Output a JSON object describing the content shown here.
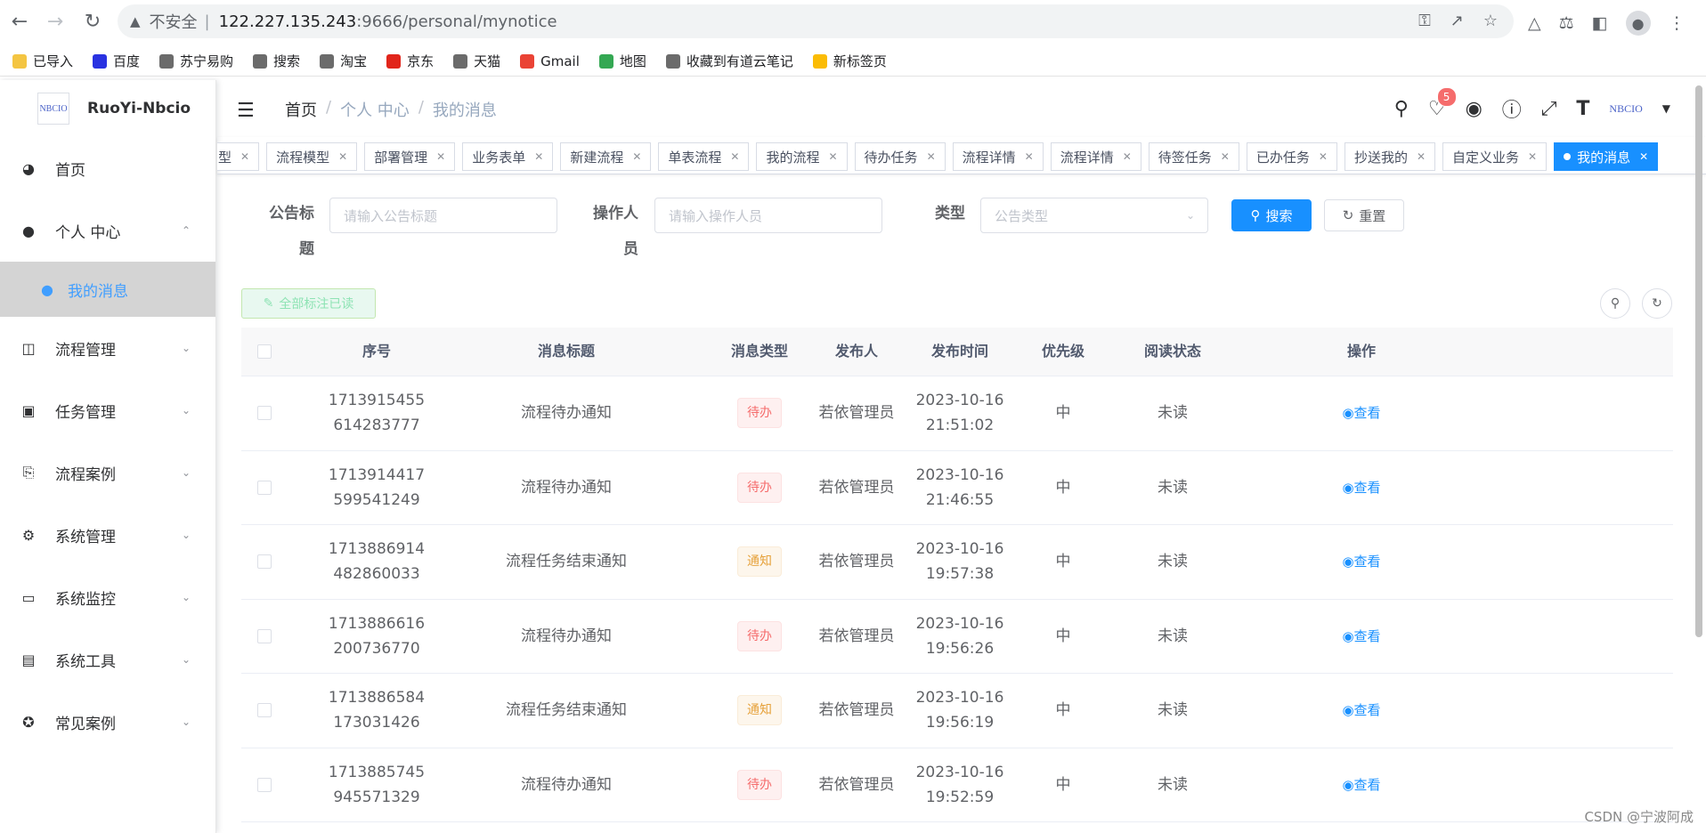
{
  "browser": {
    "security_label": "不安全",
    "url_host": "122.227.135.243",
    "url_path": ":9666/personal/mynotice",
    "bookmarks": [
      {
        "label": "已导入",
        "color": "#f4c542"
      },
      {
        "label": "百度",
        "color": "#2932e1"
      },
      {
        "label": "苏宁易购",
        "color": "#6b6b6b"
      },
      {
        "label": "搜索",
        "color": "#6b6b6b"
      },
      {
        "label": "淘宝",
        "color": "#6b6b6b"
      },
      {
        "label": "京东",
        "color": "#e1251b"
      },
      {
        "label": "天猫",
        "color": "#6b6b6b"
      },
      {
        "label": "Gmail",
        "color": "#ea4335"
      },
      {
        "label": "地图",
        "color": "#34a853"
      },
      {
        "label": "收藏到有道云笔记",
        "color": "#6b6b6b"
      },
      {
        "label": "新标签页",
        "color": "#fbbc05"
      }
    ]
  },
  "sidebar": {
    "logo_text": "NBCIO",
    "title": "RuoYi-Nbcio",
    "items": [
      {
        "label": "首页",
        "icon": "dashboard-icon"
      },
      {
        "label": "个人 中心",
        "icon": "user-icon",
        "expanded": true
      },
      {
        "label": "流程管理",
        "icon": "flow-icon"
      },
      {
        "label": "任务管理",
        "icon": "task-icon"
      },
      {
        "label": "流程案例",
        "icon": "case-icon"
      },
      {
        "label": "系统管理",
        "icon": "gear-icon"
      },
      {
        "label": "系统监控",
        "icon": "monitor-icon"
      },
      {
        "label": "系统工具",
        "icon": "toolbox-icon"
      },
      {
        "label": "常见案例",
        "icon": "example-icon"
      }
    ],
    "submenu_active": "我的消息"
  },
  "header": {
    "breadcrumb": [
      "首页",
      "个人 中心",
      "我的消息"
    ],
    "notification_count": "5",
    "avatar_text": "NBCIO"
  },
  "tags": [
    {
      "label": "型"
    },
    {
      "label": "流程模型"
    },
    {
      "label": "部署管理"
    },
    {
      "label": "业务表单"
    },
    {
      "label": "新建流程"
    },
    {
      "label": "单表流程"
    },
    {
      "label": "我的流程"
    },
    {
      "label": "待办任务"
    },
    {
      "label": "流程详情"
    },
    {
      "label": "流程详情"
    },
    {
      "label": "待签任务"
    },
    {
      "label": "已办任务"
    },
    {
      "label": "抄送我的"
    },
    {
      "label": "自定义业务"
    },
    {
      "label": "我的消息",
      "active": true
    }
  ],
  "form": {
    "title_label_1": "公告标",
    "title_label_2": "题",
    "title_placeholder": "请输入公告标题",
    "operator_label_1": "操作人",
    "operator_label_2": "员",
    "operator_placeholder": "请输入操作人员",
    "type_label": "类型",
    "type_placeholder": "公告类型",
    "search_btn": "搜索",
    "reset_btn": "重置",
    "mark_all_read": "全部标注已读"
  },
  "table": {
    "headers": [
      "序号",
      "消息标题",
      "消息类型",
      "发布人",
      "发布时间",
      "优先级",
      "阅读状态",
      "操作"
    ],
    "view_label": "查看",
    "rows": [
      {
        "no1": "1713915455",
        "no2": "614283777",
        "title": "流程待办通知",
        "type": "待办",
        "type_style": "danger",
        "publisher": "若依管理员",
        "date": "2023-10-16",
        "time": "21:51:02",
        "priority": "中",
        "status": "未读"
      },
      {
        "no1": "1713914417",
        "no2": "599541249",
        "title": "流程待办通知",
        "type": "待办",
        "type_style": "danger",
        "publisher": "若依管理员",
        "date": "2023-10-16",
        "time": "21:46:55",
        "priority": "中",
        "status": "未读"
      },
      {
        "no1": "1713886914",
        "no2": "482860033",
        "title": "流程任务结束通知",
        "type": "通知",
        "type_style": "warning",
        "publisher": "若依管理员",
        "date": "2023-10-16",
        "time": "19:57:38",
        "priority": "中",
        "status": "未读"
      },
      {
        "no1": "1713886616",
        "no2": "200736770",
        "title": "流程待办通知",
        "type": "待办",
        "type_style": "danger",
        "publisher": "若依管理员",
        "date": "2023-10-16",
        "time": "19:56:26",
        "priority": "中",
        "status": "未读"
      },
      {
        "no1": "1713886584",
        "no2": "173031426",
        "title": "流程任务结束通知",
        "type": "通知",
        "type_style": "warning",
        "publisher": "若依管理员",
        "date": "2023-10-16",
        "time": "19:56:19",
        "priority": "中",
        "status": "未读"
      },
      {
        "no1": "1713885745",
        "no2": "945571329",
        "title": "流程待办通知",
        "type": "待办",
        "type_style": "danger",
        "publisher": "若依管理员",
        "date": "2023-10-16",
        "time": "19:52:59",
        "priority": "中",
        "status": "未读"
      }
    ]
  },
  "watermark": "CSDN @宁波阿成"
}
